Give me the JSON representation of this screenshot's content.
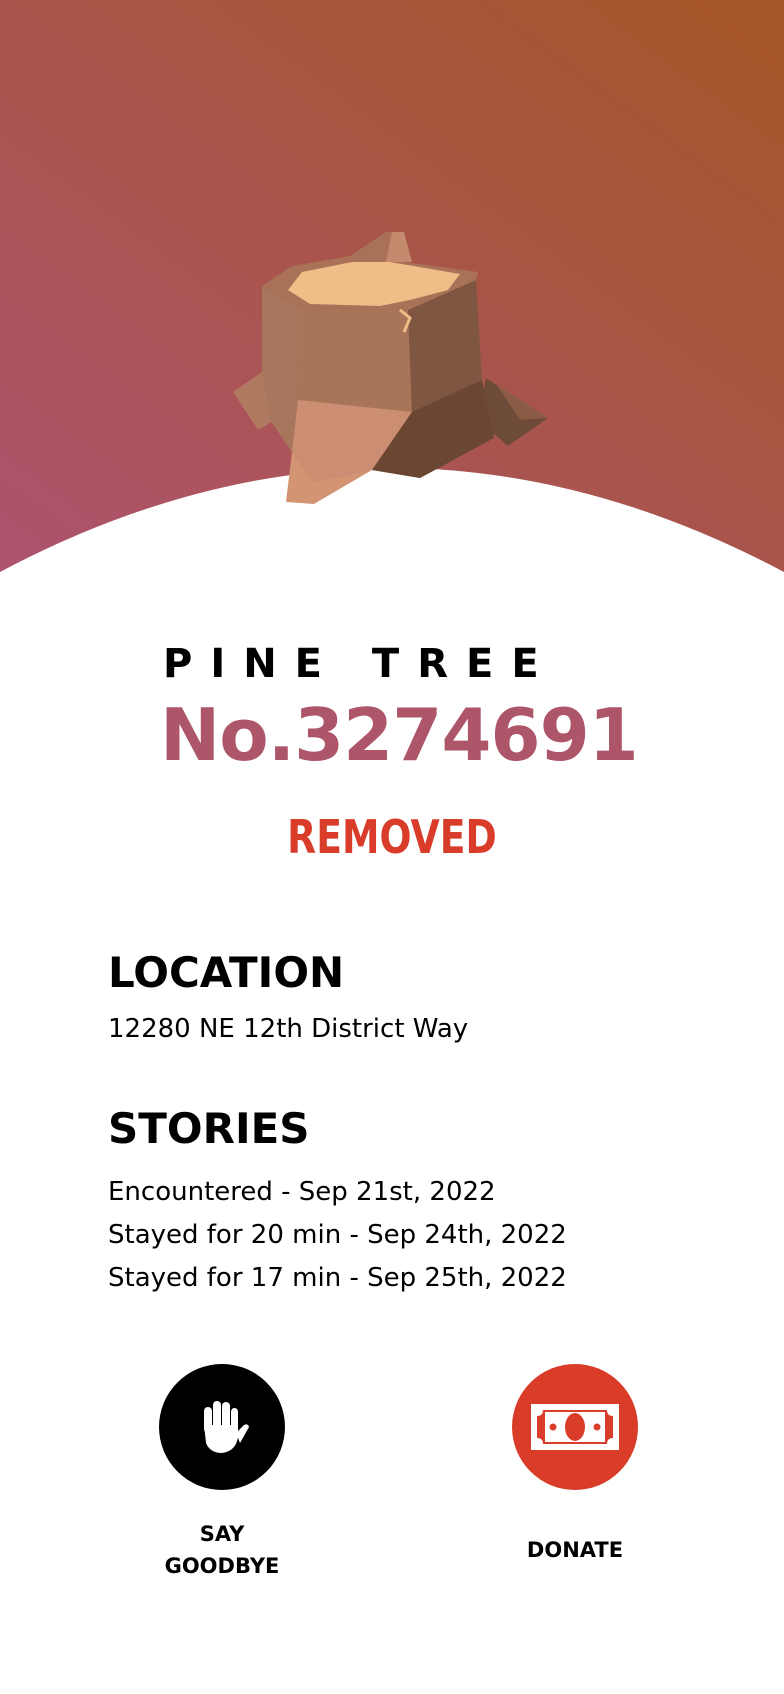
{
  "colors": {
    "gradient_left": "#ad536f",
    "gradient_right": "#a55626",
    "number": "#ad5569",
    "status": "#d93d2a",
    "goodbye_bg": "#000000",
    "donate_bg": "#d93d2a"
  },
  "hero": {
    "illustration": "tree-stump-icon"
  },
  "tree": {
    "species": "PINE TREE",
    "number": "No.3274691",
    "status": "REMOVED"
  },
  "location": {
    "title": "LOCATION",
    "address": "12280 NE 12th District Way"
  },
  "stories": {
    "title": "STORIES",
    "items": [
      "Encountered - Sep 21st, 2022",
      "Stayed for 20 min - Sep 24th, 2022",
      "Stayed for 17 min - Sep 25th, 2022"
    ]
  },
  "actions": {
    "goodbye": {
      "label": "SAY\nGOODBYE",
      "icon": "waving-hand-icon"
    },
    "donate": {
      "label": "DONATE",
      "icon": "banknote-icon"
    }
  }
}
